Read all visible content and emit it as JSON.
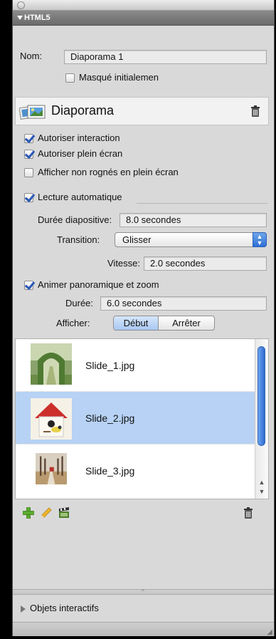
{
  "section": {
    "title": "HTML5"
  },
  "name": {
    "label": "Nom:",
    "value": "Diaporama 1"
  },
  "hidden": {
    "label": "Masqué initialemen",
    "checked": false
  },
  "widget": {
    "title": "Diaporama"
  },
  "options": [
    {
      "label": "Autoriser interaction",
      "checked": true
    },
    {
      "label": "Autoriser plein écran",
      "checked": true
    },
    {
      "label": "Afficher non rognés en plein écran",
      "checked": false
    }
  ],
  "autoplay": {
    "label": "Lecture automatique",
    "checked": true
  },
  "slide_duration": {
    "label": "Durée diapositive:",
    "value": "8.0 secondes"
  },
  "transition": {
    "label": "Transition:",
    "value": "Glisser"
  },
  "speed": {
    "label": "Vitesse:",
    "value": "2.0 secondes"
  },
  "panzoom": {
    "label": "Animer panoramique et zoom",
    "checked": true
  },
  "duration": {
    "label": "Durée:",
    "value": "6.0 secondes"
  },
  "show": {
    "label": "Afficher:",
    "options": [
      "Début",
      "Arrêter"
    ],
    "selected": "Début"
  },
  "slides": [
    {
      "label": "Slide_1.jpg",
      "selected": false,
      "icon": "garden-arch-thumbnail"
    },
    {
      "label": "Slide_2.jpg",
      "selected": true,
      "icon": "birdhouse-thumbnail"
    },
    {
      "label": "Slide_3.jpg",
      "selected": false,
      "icon": "autumn-trees-thumbnail"
    }
  ],
  "list_toolbar": {
    "icons": [
      "add-icon",
      "pencil-icon",
      "film-clapper-icon",
      "trash-icon"
    ]
  },
  "objects": {
    "label": "Objets interactifs"
  },
  "colors": {
    "accent": "#2e6fd6",
    "selection": "#b7d2f4",
    "panel": "#d9d9d9"
  }
}
